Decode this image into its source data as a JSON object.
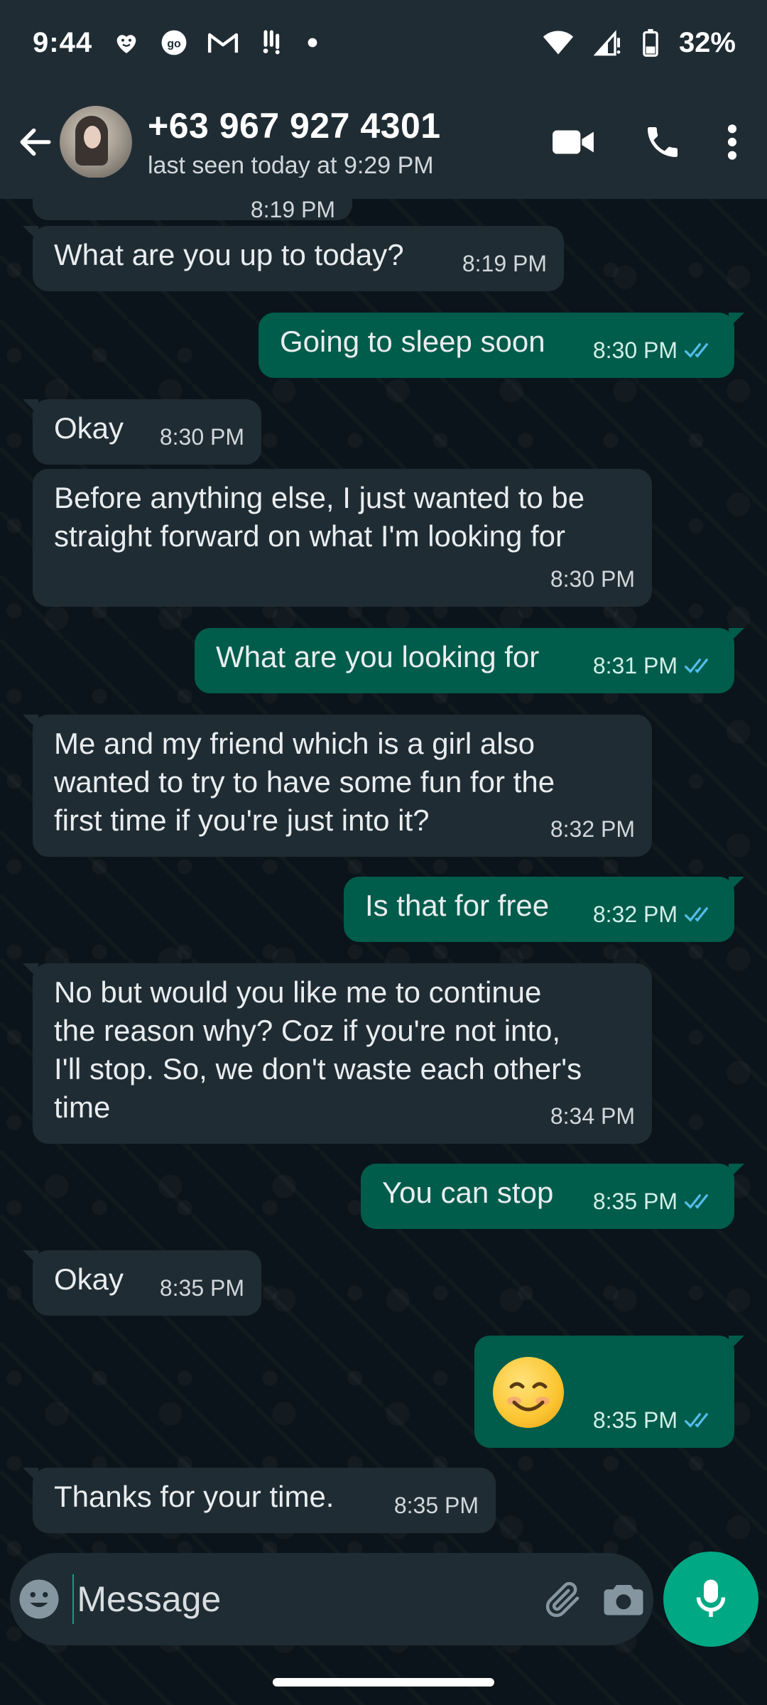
{
  "status_bar": {
    "time": "9:44",
    "battery": "32%",
    "icons": [
      "heart-icon",
      "go-icon",
      "gmail-icon",
      "alert-icon",
      "dot-icon",
      "wifi-icon",
      "signal-icon",
      "battery-icon"
    ]
  },
  "header": {
    "contact_name": "+63 967 927 4301",
    "last_seen": "last seen today at 9:29 PM",
    "icons": [
      "back-arrow-icon",
      "video-call-icon",
      "phone-icon",
      "more-vert-icon"
    ]
  },
  "messages": [
    {
      "dir": "in",
      "text": "What are you up to today?",
      "time": "8:19 PM"
    },
    {
      "dir": "out",
      "text": "Going to sleep soon",
      "time": "8:30 PM",
      "read": true
    },
    {
      "dir": "in",
      "text": "Okay",
      "time": "8:30 PM"
    },
    {
      "dir": "in",
      "lines": [
        "Before anything else, I just wanted to be",
        "straight forward on what I'm looking for"
      ],
      "time": "8:30 PM"
    },
    {
      "dir": "out",
      "text": "What are you looking for",
      "time": "8:31 PM",
      "read": true
    },
    {
      "dir": "in",
      "lines": [
        "Me and my friend which is a girl also",
        "wanted to try to have some fun for the",
        "first time if you're just into it?"
      ],
      "time": "8:32 PM"
    },
    {
      "dir": "out",
      "text": "Is that for free",
      "time": "8:32 PM",
      "read": true
    },
    {
      "dir": "in",
      "lines": [
        "No but would you like me to continue",
        "the reason why? Coz if you're not into,",
        "I'll stop. So, we don't waste each other's",
        "time"
      ],
      "time": "8:34 PM"
    },
    {
      "dir": "out",
      "text": "You can stop",
      "time": "8:35 PM",
      "read": true
    },
    {
      "dir": "in",
      "text": "Okay",
      "time": "8:35 PM"
    },
    {
      "dir": "out",
      "emoji": "smiling-face-emoji",
      "time": "8:35 PM",
      "read": true
    },
    {
      "dir": "in",
      "text": "Thanks for your time.",
      "time": "8:35 PM"
    }
  ],
  "partial_top_time": "8:19 PM",
  "composer": {
    "placeholder": "Message",
    "icons": [
      "emoji-icon",
      "attach-icon",
      "camera-icon",
      "mic-icon"
    ]
  },
  "colors": {
    "background": "#0b141a",
    "bar": "#1f2c34",
    "incoming": "#202c33",
    "outgoing": "#005c4b",
    "accent": "#00a884",
    "read_tick": "#53bdeb"
  }
}
